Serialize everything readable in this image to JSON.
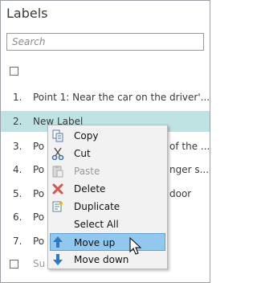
{
  "panel": {
    "title": "Labels",
    "search_placeholder": "Search"
  },
  "list": [
    {
      "num": "1.",
      "label": "Point 1: Near the car on the driver'..."
    },
    {
      "num": "2.",
      "label": "New Label"
    },
    {
      "num": "3.",
      "label": "Po",
      "label_tail": "of the ..."
    },
    {
      "num": "4.",
      "label": "Po",
      "label_tail": "nger s..."
    },
    {
      "num": "5.",
      "label": "Po",
      "label_tail": "door"
    },
    {
      "num": "6.",
      "label": "Po"
    },
    {
      "num": "7.",
      "label": "Po"
    }
  ],
  "footer": {
    "text": "Su"
  },
  "context_menu": [
    {
      "label": "Copy",
      "icon": "copy-icon",
      "disabled": false
    },
    {
      "label": "Cut",
      "icon": "scissors-icon",
      "disabled": false
    },
    {
      "label": "Paste",
      "icon": "paste-icon",
      "disabled": true
    },
    {
      "label": "Delete",
      "icon": "delete-icon",
      "disabled": false
    },
    {
      "label": "Duplicate",
      "icon": "duplicate-icon",
      "disabled": false
    },
    {
      "label": "Select All",
      "icon": "",
      "disabled": false
    },
    {
      "label": "Move up",
      "icon": "arrow-up-icon",
      "disabled": false,
      "highlighted": true
    },
    {
      "label": "Move down",
      "icon": "arrow-down-icon",
      "disabled": false
    }
  ],
  "colors": {
    "selected_row": "#bfe3e3",
    "menu_highlight": "#92c7ee",
    "arrow_blue": "#2f79c4",
    "delete_red": "#d9534f"
  }
}
